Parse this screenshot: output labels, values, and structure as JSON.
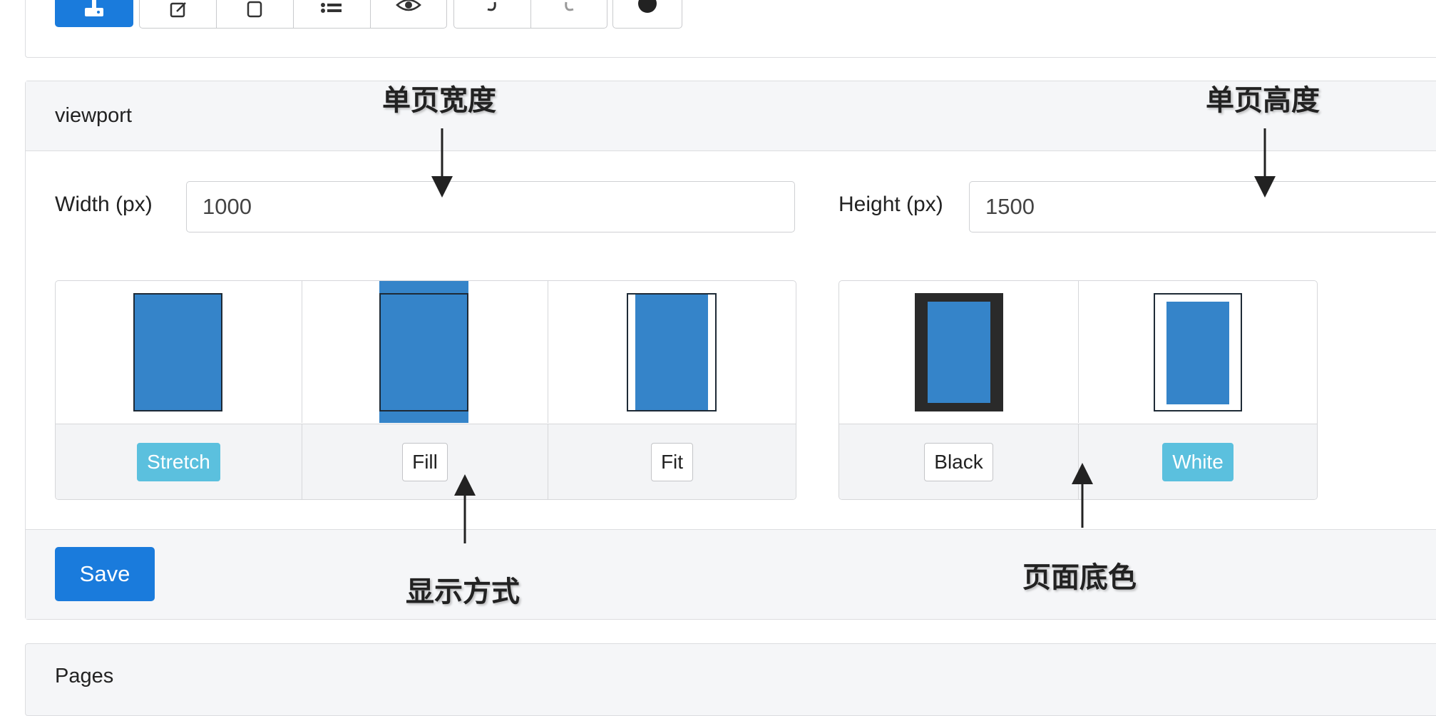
{
  "toolbar": {
    "primary_icon": "upload-icon",
    "group1_icons": [
      "edit-icon",
      "page-icon",
      "list-icon",
      "eye-icon"
    ],
    "group2_icons": [
      "undo-icon",
      "redo-icon"
    ],
    "group3_icons": [
      "record-icon"
    ]
  },
  "viewport": {
    "title": "viewport",
    "width_label": "Width (px)",
    "width_value": "1000",
    "height_label": "Height (px)",
    "height_value": "1500",
    "display_modes": [
      {
        "label": "Stretch",
        "active": true
      },
      {
        "label": "Fill",
        "active": false
      },
      {
        "label": "Fit",
        "active": false
      }
    ],
    "background_colors": [
      {
        "label": "Black",
        "active": false
      },
      {
        "label": "White",
        "active": true
      }
    ],
    "save_label": "Save"
  },
  "pages": {
    "title": "Pages"
  },
  "annotations": {
    "width_note": "单页宽度",
    "height_note": "单页高度",
    "display_note": "显示方式",
    "bgcolor_note": "页面底色"
  },
  "colors": {
    "primary": "#1a7bdc",
    "active_option": "#5bc0de",
    "preview_blue": "#3584c9",
    "preview_dark": "#2a2a2a"
  }
}
